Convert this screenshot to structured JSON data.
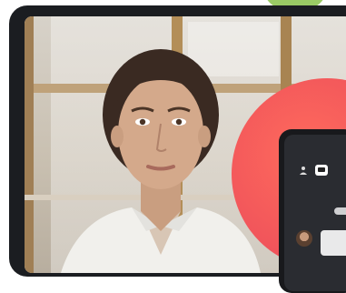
{
  "scene": {
    "description": "",
    "accent_color": "#f2575b",
    "secondary_color": "#8fc454"
  },
  "tablet": {
    "content": "video-call-portrait"
  },
  "phone": {
    "icons": [
      "person-icon",
      "chat-icon"
    ]
  }
}
